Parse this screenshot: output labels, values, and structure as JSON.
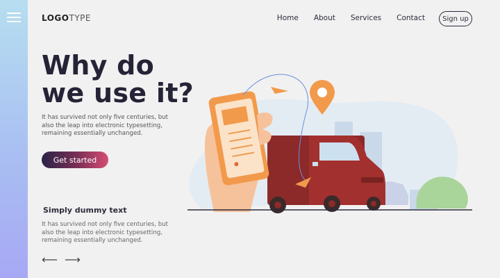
{
  "logo": {
    "bold": "LOGO",
    "light": "TYPE"
  },
  "nav": {
    "items": [
      {
        "label": "Home"
      },
      {
        "label": "About"
      },
      {
        "label": "Services"
      },
      {
        "label": "Contact"
      }
    ]
  },
  "signup_label": "Sign up",
  "hero": {
    "title": "Why do we use it?",
    "description": "It has survived not only five centuries, but also the leap into electronic typesetting, remaining essentially unchanged.",
    "cta_label": "Get started"
  },
  "secondary": {
    "title": "Simply dummy text",
    "description": "It has survived not only five centuries, but also the leap into electronic typesetting, remaining essentially unchanged."
  },
  "pager": {
    "prev": "⟵",
    "next": "⟶"
  },
  "colors": {
    "sidebar_top": "#b6def0",
    "sidebar_bottom": "#a7a8f4",
    "cta_start": "#2b2348",
    "cta_end": "#d64d74",
    "truck": "#a2302e",
    "pin": "#f29a4c"
  }
}
